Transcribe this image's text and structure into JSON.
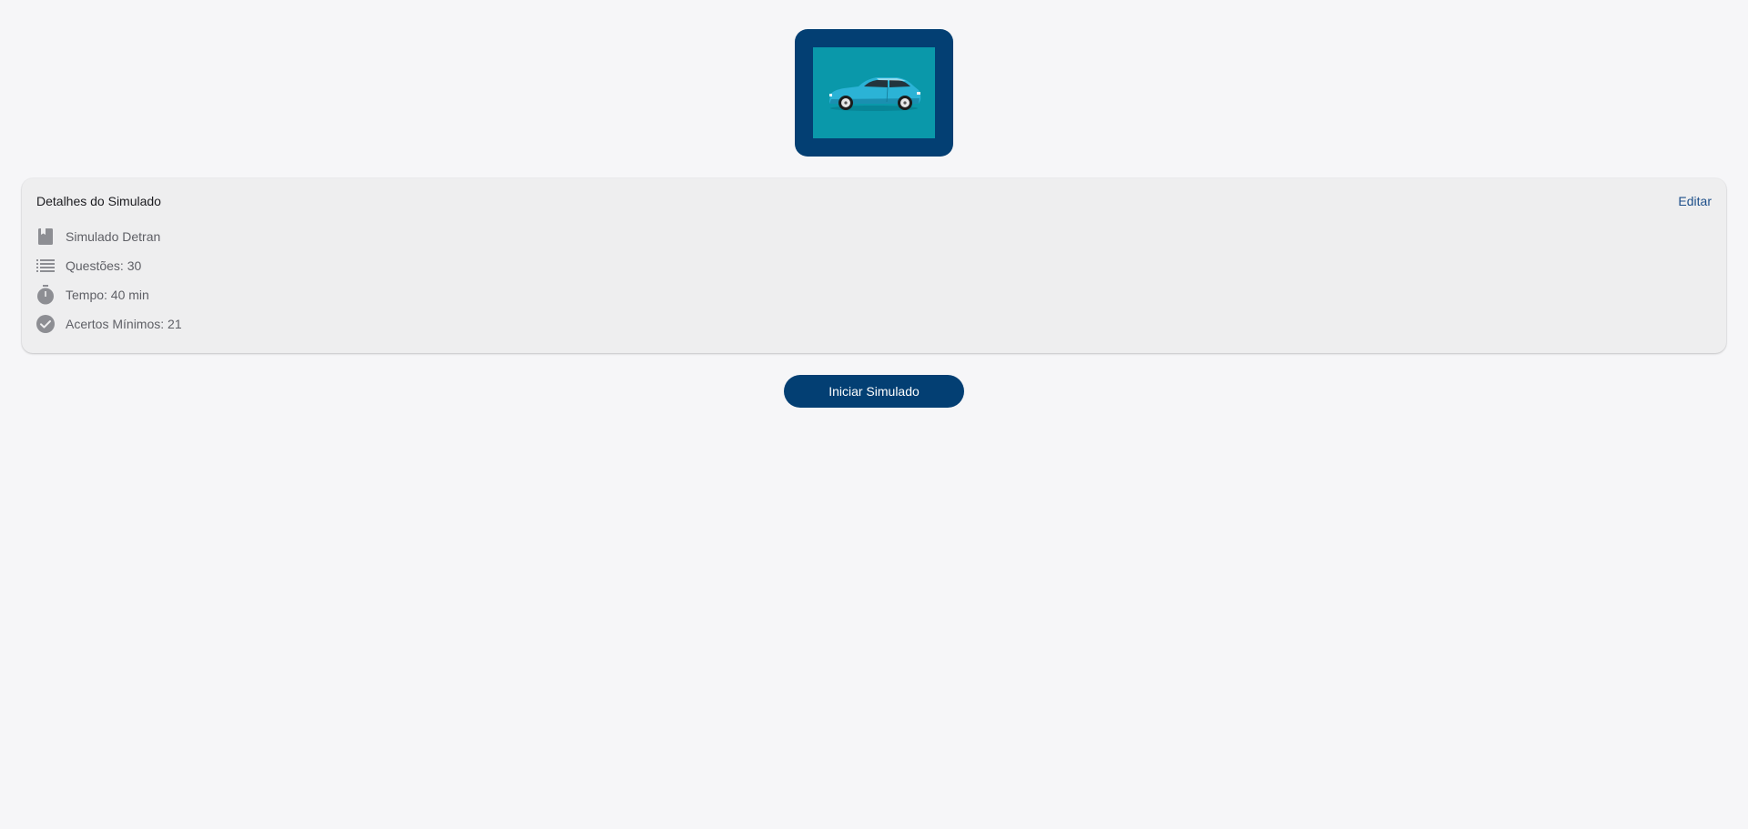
{
  "hero": {
    "image_icon": "car-image",
    "frame_color": "#033f73",
    "image_bg_color": "#0a98aa"
  },
  "details": {
    "title": "Detalhes do Simulado",
    "edit_label": "Editar",
    "items": [
      {
        "icon": "book-icon",
        "label": "Simulado Detran"
      },
      {
        "icon": "list-icon",
        "label": "Questões: 30"
      },
      {
        "icon": "timer-icon",
        "label": "Tempo: 40 min"
      },
      {
        "icon": "check-circle-icon",
        "label": "Acertos Mínimos: 21"
      }
    ]
  },
  "actions": {
    "start_label": "Iniciar Simulado",
    "accent_color": "#033f73"
  }
}
